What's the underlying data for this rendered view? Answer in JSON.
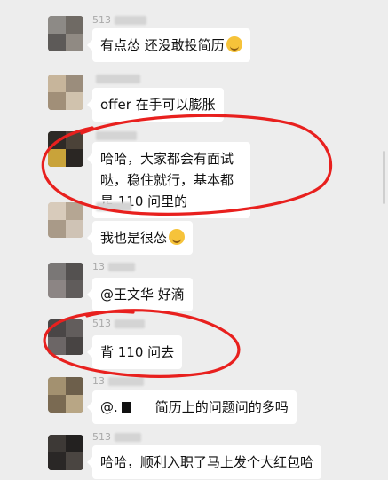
{
  "messages": [
    {
      "nick": "513",
      "text": "有点怂 还没敢投简历",
      "emoji": "crying-laughing-emoji"
    },
    {
      "nick": "",
      "text": "offer 在手可以膨胀"
    },
    {
      "nick": "",
      "text": "哈哈，大家都会有面试哒，稳住就行，基本都是 110 问里的"
    },
    {
      "nick": "",
      "text": "我也是很怂",
      "emoji": "crying-laughing-emoji"
    },
    {
      "nick": "13",
      "text": "@王文华 好滴"
    },
    {
      "nick": "513",
      "text": "背 110 问去"
    },
    {
      "nick": "13",
      "text_a": "@.",
      "text_b": "简历上的问题问的多吗"
    },
    {
      "nick": "513",
      "text": "哈哈，顺利入职了马上发个大红包哈"
    }
  ],
  "colors": {
    "background": "#ededed",
    "bubble": "#ffffff",
    "annotation_red": "#e8201e"
  }
}
